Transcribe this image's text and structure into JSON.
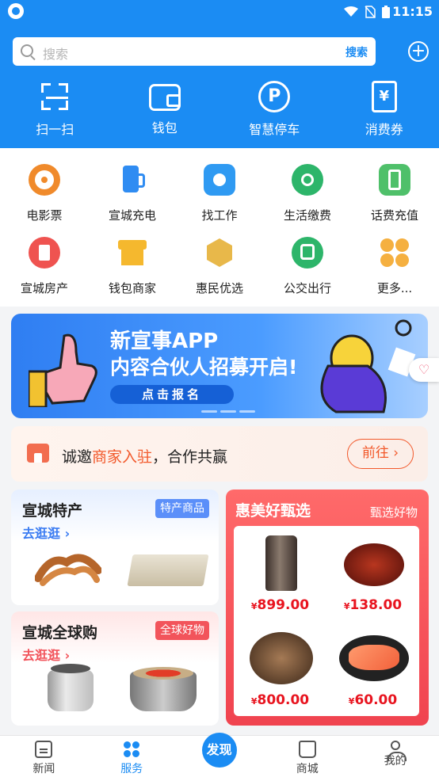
{
  "status_bar": {
    "time": "11:15"
  },
  "search": {
    "placeholder": "搜索",
    "button_label": "搜索"
  },
  "top_nav": [
    {
      "label": "扫一扫",
      "icon": "scan-icon"
    },
    {
      "label": "钱包",
      "icon": "wallet-icon"
    },
    {
      "label": "智慧停车",
      "icon": "parking-icon",
      "glyph": "P"
    },
    {
      "label": "消费券",
      "icon": "voucher-icon",
      "glyph": "¥"
    }
  ],
  "services": [
    {
      "label": "电影票",
      "icon": "movie-ticket-icon",
      "color": "#f08a2b"
    },
    {
      "label": "宣城充电",
      "icon": "charging-pile-icon",
      "color": "#2f8cf2"
    },
    {
      "label": "找工作",
      "icon": "job-search-icon",
      "color": "#2f9af2"
    },
    {
      "label": "生活缴费",
      "icon": "utility-payment-icon",
      "color": "#2db56a"
    },
    {
      "label": "话费充值",
      "icon": "phone-recharge-icon",
      "color": "#4fc06a"
    },
    {
      "label": "宣城房产",
      "icon": "real-estate-icon",
      "color": "#ef5350"
    },
    {
      "label": "钱包商家",
      "icon": "merchant-store-icon",
      "color": "#f5b82e"
    },
    {
      "label": "惠民优选",
      "icon": "gift-box-icon",
      "color": "#e8b84a"
    },
    {
      "label": "公交出行",
      "icon": "bus-icon",
      "color": "#2db56a"
    },
    {
      "label": "更多...",
      "icon": "more-icon",
      "color": "#f5b040"
    }
  ],
  "banner": {
    "line1": "新宣事APP",
    "line2": "内容合伙人招募开启!",
    "button": "点击报名"
  },
  "merchant": {
    "prefix": "诚邀",
    "highlight": "商家入驻",
    "suffix": "，合作共赢",
    "button": "前往"
  },
  "card_specialty": {
    "title": "宣城特产",
    "tag": "特产商品",
    "link": "去逛逛"
  },
  "card_global": {
    "title": "宣城全球购",
    "tag": "全球好物",
    "link": "去逛逛"
  },
  "card_selection": {
    "title": "惠美好甄选",
    "subtitle": "甄选好物",
    "products": [
      {
        "price": "899.00",
        "image": "soymilk-maker"
      },
      {
        "price": "138.00",
        "image": "lobster"
      },
      {
        "price": "800.00",
        "image": "crab"
      },
      {
        "price": "60.00",
        "image": "salmon"
      }
    ],
    "currency": "¥"
  },
  "bottom_nav": [
    {
      "label": "新闻"
    },
    {
      "label": "服务"
    },
    {
      "label": "发现"
    },
    {
      "label": "商城"
    },
    {
      "label": "我的"
    }
  ],
  "colors": {
    "primary": "#1b8cf3",
    "accent_red": "#f2545b",
    "price_red": "#e8141f"
  }
}
